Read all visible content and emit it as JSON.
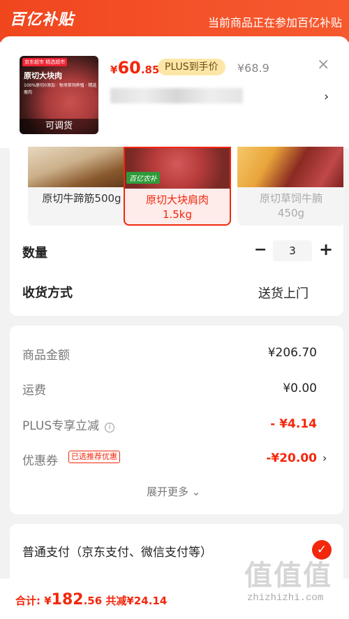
{
  "header": {
    "brand": "百亿补贴",
    "promo": "当前商品正在参加百亿补贴"
  },
  "product": {
    "thumb_badge": "京东超市 精选超市",
    "thumb_title": "原切大块肉",
    "thumb_points": "100%原切0添加 · 牧场草饲养殖 · 精选瘦肉",
    "adjustable": "可调货",
    "price_symbol": "¥",
    "price_int": "60",
    "price_dec": ".85",
    "plus_label": "PLUS到手价",
    "original_price": "¥68.9",
    "close_symbol": "×",
    "chevron": "›"
  },
  "variants": [
    {
      "label": "原切牛蹄筋500g",
      "selected": false,
      "available": true
    },
    {
      "label": "原切大块肩肉 1.5kg",
      "selected": true,
      "available": true,
      "badge": "百亿农补"
    },
    {
      "label": "原切草饲牛腩 450g",
      "selected": false,
      "available": false
    }
  ],
  "quantity": {
    "label": "数量",
    "minus": "−",
    "value": "3",
    "plus": "+"
  },
  "delivery": {
    "label": "收货方式",
    "value": "送货上门"
  },
  "summary": {
    "rows": [
      {
        "label": "商品金额",
        "value": "¥206.70"
      },
      {
        "label": "运费",
        "value": "¥0.00"
      },
      {
        "label": "PLUS专享立减",
        "value": "- ¥4.14"
      },
      {
        "label": "优惠券",
        "value": "-¥20.00"
      }
    ],
    "coupon_tag": "已选推荐优惠",
    "info_symbol": "i",
    "expand": "展开更多 ⌄"
  },
  "payment": {
    "label": "普通支付（京东支付、微信支付等）",
    "check": "✓"
  },
  "footer": {
    "total_label": "合计: ¥",
    "total_int": "182",
    "total_dec": ".56",
    "saved": "共减¥24.14"
  },
  "watermark": {
    "glyphs": "值值值",
    "text": "zhizhizhi.com"
  },
  "colors": {
    "accent": "#f2270c",
    "header_bg": "#f4532a",
    "plus_tag_bg": "#fde7a8"
  }
}
